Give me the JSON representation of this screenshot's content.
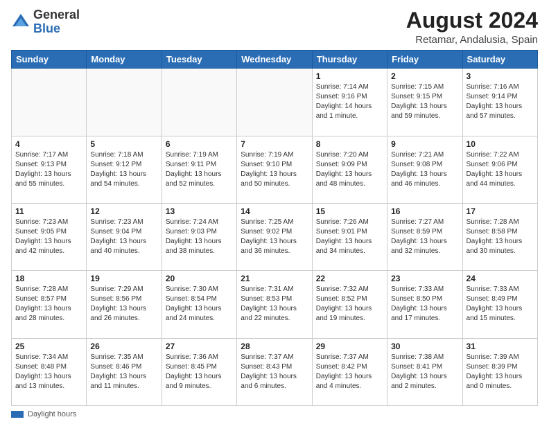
{
  "header": {
    "logo_general": "General",
    "logo_blue": "Blue",
    "month_year": "August 2024",
    "location": "Retamar, Andalusia, Spain"
  },
  "footer": {
    "label": "Daylight hours"
  },
  "days_of_week": [
    "Sunday",
    "Monday",
    "Tuesday",
    "Wednesday",
    "Thursday",
    "Friday",
    "Saturday"
  ],
  "weeks": [
    {
      "days": [
        {
          "number": "",
          "info": ""
        },
        {
          "number": "",
          "info": ""
        },
        {
          "number": "",
          "info": ""
        },
        {
          "number": "",
          "info": ""
        },
        {
          "number": "1",
          "info": "Sunrise: 7:14 AM\nSunset: 9:16 PM\nDaylight: 14 hours and 1 minute."
        },
        {
          "number": "2",
          "info": "Sunrise: 7:15 AM\nSunset: 9:15 PM\nDaylight: 13 hours and 59 minutes."
        },
        {
          "number": "3",
          "info": "Sunrise: 7:16 AM\nSunset: 9:14 PM\nDaylight: 13 hours and 57 minutes."
        }
      ]
    },
    {
      "days": [
        {
          "number": "4",
          "info": "Sunrise: 7:17 AM\nSunset: 9:13 PM\nDaylight: 13 hours and 55 minutes."
        },
        {
          "number": "5",
          "info": "Sunrise: 7:18 AM\nSunset: 9:12 PM\nDaylight: 13 hours and 54 minutes."
        },
        {
          "number": "6",
          "info": "Sunrise: 7:19 AM\nSunset: 9:11 PM\nDaylight: 13 hours and 52 minutes."
        },
        {
          "number": "7",
          "info": "Sunrise: 7:19 AM\nSunset: 9:10 PM\nDaylight: 13 hours and 50 minutes."
        },
        {
          "number": "8",
          "info": "Sunrise: 7:20 AM\nSunset: 9:09 PM\nDaylight: 13 hours and 48 minutes."
        },
        {
          "number": "9",
          "info": "Sunrise: 7:21 AM\nSunset: 9:08 PM\nDaylight: 13 hours and 46 minutes."
        },
        {
          "number": "10",
          "info": "Sunrise: 7:22 AM\nSunset: 9:06 PM\nDaylight: 13 hours and 44 minutes."
        }
      ]
    },
    {
      "days": [
        {
          "number": "11",
          "info": "Sunrise: 7:23 AM\nSunset: 9:05 PM\nDaylight: 13 hours and 42 minutes."
        },
        {
          "number": "12",
          "info": "Sunrise: 7:23 AM\nSunset: 9:04 PM\nDaylight: 13 hours and 40 minutes."
        },
        {
          "number": "13",
          "info": "Sunrise: 7:24 AM\nSunset: 9:03 PM\nDaylight: 13 hours and 38 minutes."
        },
        {
          "number": "14",
          "info": "Sunrise: 7:25 AM\nSunset: 9:02 PM\nDaylight: 13 hours and 36 minutes."
        },
        {
          "number": "15",
          "info": "Sunrise: 7:26 AM\nSunset: 9:01 PM\nDaylight: 13 hours and 34 minutes."
        },
        {
          "number": "16",
          "info": "Sunrise: 7:27 AM\nSunset: 8:59 PM\nDaylight: 13 hours and 32 minutes."
        },
        {
          "number": "17",
          "info": "Sunrise: 7:28 AM\nSunset: 8:58 PM\nDaylight: 13 hours and 30 minutes."
        }
      ]
    },
    {
      "days": [
        {
          "number": "18",
          "info": "Sunrise: 7:28 AM\nSunset: 8:57 PM\nDaylight: 13 hours and 28 minutes."
        },
        {
          "number": "19",
          "info": "Sunrise: 7:29 AM\nSunset: 8:56 PM\nDaylight: 13 hours and 26 minutes."
        },
        {
          "number": "20",
          "info": "Sunrise: 7:30 AM\nSunset: 8:54 PM\nDaylight: 13 hours and 24 minutes."
        },
        {
          "number": "21",
          "info": "Sunrise: 7:31 AM\nSunset: 8:53 PM\nDaylight: 13 hours and 22 minutes."
        },
        {
          "number": "22",
          "info": "Sunrise: 7:32 AM\nSunset: 8:52 PM\nDaylight: 13 hours and 19 minutes."
        },
        {
          "number": "23",
          "info": "Sunrise: 7:33 AM\nSunset: 8:50 PM\nDaylight: 13 hours and 17 minutes."
        },
        {
          "number": "24",
          "info": "Sunrise: 7:33 AM\nSunset: 8:49 PM\nDaylight: 13 hours and 15 minutes."
        }
      ]
    },
    {
      "days": [
        {
          "number": "25",
          "info": "Sunrise: 7:34 AM\nSunset: 8:48 PM\nDaylight: 13 hours and 13 minutes."
        },
        {
          "number": "26",
          "info": "Sunrise: 7:35 AM\nSunset: 8:46 PM\nDaylight: 13 hours and 11 minutes."
        },
        {
          "number": "27",
          "info": "Sunrise: 7:36 AM\nSunset: 8:45 PM\nDaylight: 13 hours and 9 minutes."
        },
        {
          "number": "28",
          "info": "Sunrise: 7:37 AM\nSunset: 8:43 PM\nDaylight: 13 hours and 6 minutes."
        },
        {
          "number": "29",
          "info": "Sunrise: 7:37 AM\nSunset: 8:42 PM\nDaylight: 13 hours and 4 minutes."
        },
        {
          "number": "30",
          "info": "Sunrise: 7:38 AM\nSunset: 8:41 PM\nDaylight: 13 hours and 2 minutes."
        },
        {
          "number": "31",
          "info": "Sunrise: 7:39 AM\nSunset: 8:39 PM\nDaylight: 13 hours and 0 minutes."
        }
      ]
    }
  ]
}
